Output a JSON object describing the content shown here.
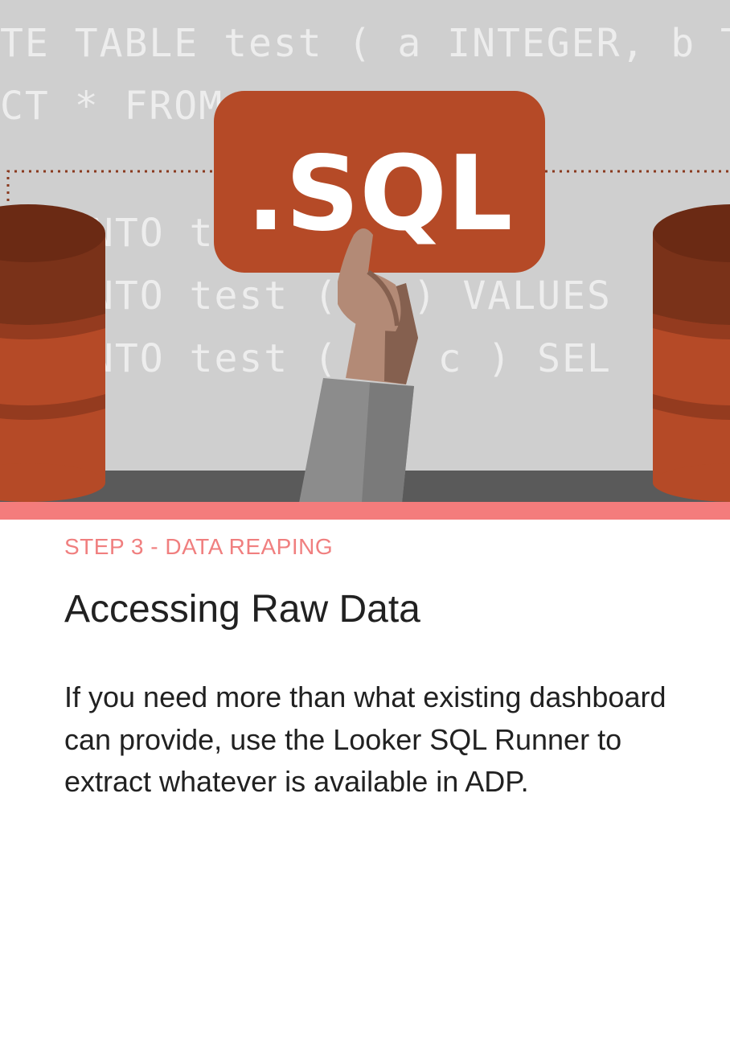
{
  "illustration": {
    "badge_text": ".SQL",
    "code_lines": [
      "TE TABLE test ( a INTEGER, b TEX",
      "CT * FROM",
      "NTO to                       'Thi",
      "NTO test (      c ) VALUES",
      "NTO test (      b, c ) SEL"
    ],
    "colors": {
      "background": "#cfcfcf",
      "badge": "#b54a27",
      "database_dark": "#7a3219",
      "database_mid": "#b54a27",
      "desk": "#5a5a5a",
      "accent_stripe": "#f47c7c"
    },
    "icons": [
      "database-icon-left",
      "database-icon-right",
      "hand-holding-sign-icon"
    ]
  },
  "content": {
    "step_label": "STEP 3 - DATA REAPING",
    "title": "Accessing Raw Data",
    "body": "If you need more than what existing dashboard can provide, use the Looker SQL Runner to extract whatever is available in ADP."
  }
}
